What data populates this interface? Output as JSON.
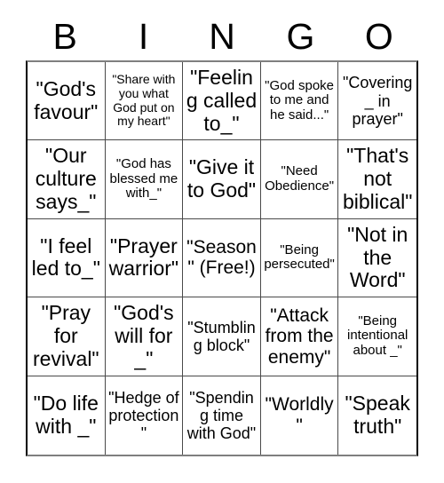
{
  "card": {
    "title_letters": [
      "B",
      "I",
      "N",
      "G",
      "O"
    ],
    "columns": [
      "B",
      "I",
      "N",
      "G",
      "O"
    ],
    "rows": [
      [
        "\"God's favour\"",
        "\"Share with you what God put on my heart\"",
        "\"Feeling called to_\"",
        "\"God spoke to me and he said...\"",
        "\"Covering _ in prayer\""
      ],
      [
        "\"Our culture says_\"",
        "\"God has blessed me with_\"",
        "\"Give it to God\"",
        "\"Need Obedience\"",
        "\"That's not biblical\""
      ],
      [
        "\"I feel led to_\"",
        "\"Prayer warrior\"",
        "\"Season\" (Free!)",
        "\"Being persecuted\"",
        "\"Not in the Word\""
      ],
      [
        "\"Pray for revival\"",
        "\"God's will for _\"",
        "\"Stumbling block\"",
        "\"Attack from the enemy\"",
        "\"Being intentional about _\""
      ],
      [
        "\"Do life with _\"",
        "\"Hedge of protection\"",
        "\"Spending time with God\"",
        "\"Worldly\"",
        "\"Speak truth\""
      ]
    ],
    "free_space": {
      "row": 2,
      "column": 2,
      "label": "\"Season\" (Free!)"
    },
    "colors": {
      "background": "#ffffff",
      "text": "#000000",
      "grid_line": "#4a4a4a",
      "outer_border": "#7f7f7f"
    }
  }
}
